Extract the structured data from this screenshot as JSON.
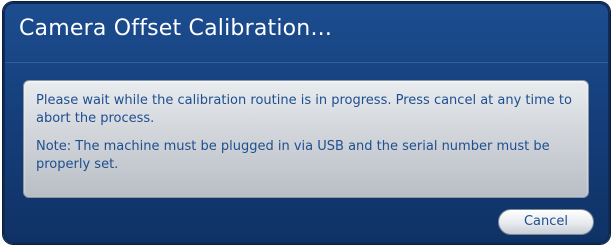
{
  "dialog": {
    "title": "Camera Offset Calibration...",
    "message": {
      "paragraph1": "Please wait while the calibration routine is in progress. Press cancel at any time to abort the process.",
      "paragraph2": "Note: The machine must be plugged in via USB and the serial number must be properly set."
    },
    "buttons": {
      "cancel_label": "Cancel"
    }
  },
  "colors": {
    "dialog_background": "#153f7c",
    "title_text": "#ffffff",
    "message_text": "#1e4f8f",
    "panel_background": "#d4d8dd"
  }
}
